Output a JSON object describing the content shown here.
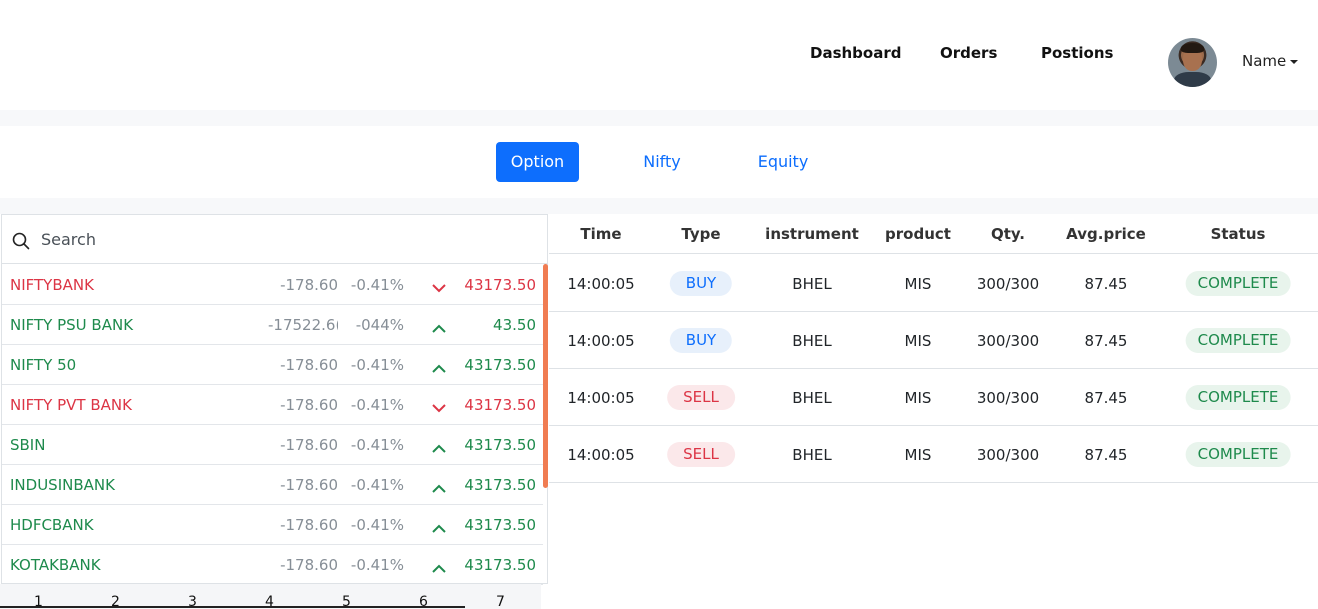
{
  "nav": {
    "links": [
      "Dashboard",
      "Orders",
      "Postions"
    ],
    "user_name": "Name"
  },
  "tabs": [
    "Option",
    "Nifty",
    "Equity"
  ],
  "active_tab": "Option",
  "watchlist": {
    "search_placeholder": "Search",
    "rows": [
      {
        "name": "NIFTYBANK",
        "change": "-178.60",
        "percent": "-0.41%",
        "trend": "down",
        "ltp": "43173.50"
      },
      {
        "name": "NIFTY PSU BANK",
        "change": "-17522.6(",
        "percent": "-044%",
        "trend": "up",
        "ltp": "43.50"
      },
      {
        "name": "NIFTY 50",
        "change": "-178.60",
        "percent": "-0.41%",
        "trend": "up",
        "ltp": "43173.50"
      },
      {
        "name": "NIFTY PVT BANK",
        "change": "-178.60",
        "percent": "-0.41%",
        "trend": "down",
        "ltp": "43173.50"
      },
      {
        "name": "SBIN",
        "change": "-178.60",
        "percent": "-0.41%",
        "trend": "up",
        "ltp": "43173.50"
      },
      {
        "name": "INDUSINBANK",
        "change": "-178.60",
        "percent": "-0.41%",
        "trend": "up",
        "ltp": "43173.50"
      },
      {
        "name": "HDFCBANK",
        "change": "-178.60",
        "percent": "-0.41%",
        "trend": "up",
        "ltp": "43173.50"
      },
      {
        "name": "KOTAKBANK",
        "change": "-178.60",
        "percent": "-0.41%",
        "trend": "up",
        "ltp": "43173.50"
      }
    ],
    "pages": [
      "1",
      "2",
      "3",
      "4",
      "5",
      "6",
      "7"
    ]
  },
  "orders": {
    "columns": [
      "Time",
      "Type",
      "instrument",
      "product",
      "Qty.",
      "Avg.price",
      "Status"
    ],
    "rows": [
      {
        "time": "14:00:05",
        "type": "BUY",
        "instrument": "BHEL",
        "product": "MIS",
        "qty": "300/300",
        "avg_price": "87.45",
        "status": "COMPLETE"
      },
      {
        "time": "14:00:05",
        "type": "BUY",
        "instrument": "BHEL",
        "product": "MIS",
        "qty": "300/300",
        "avg_price": "87.45",
        "status": "COMPLETE"
      },
      {
        "time": "14:00:05",
        "type": "SELL",
        "instrument": "BHEL",
        "product": "MIS",
        "qty": "300/300",
        "avg_price": "87.45",
        "status": "COMPLETE"
      },
      {
        "time": "14:00:05",
        "type": "SELL",
        "instrument": "BHEL",
        "product": "MIS",
        "qty": "300/300",
        "avg_price": "87.45",
        "status": "COMPLETE"
      }
    ]
  },
  "colors": {
    "primary": "#0d6efd",
    "up": "#1e8a4c",
    "down": "#dc3545",
    "scrollbar": "#f07c52"
  },
  "icons": {
    "search": "search-icon",
    "up": "chevron-up-icon",
    "down": "chevron-down-icon",
    "user_menu": "caret-down-icon"
  }
}
